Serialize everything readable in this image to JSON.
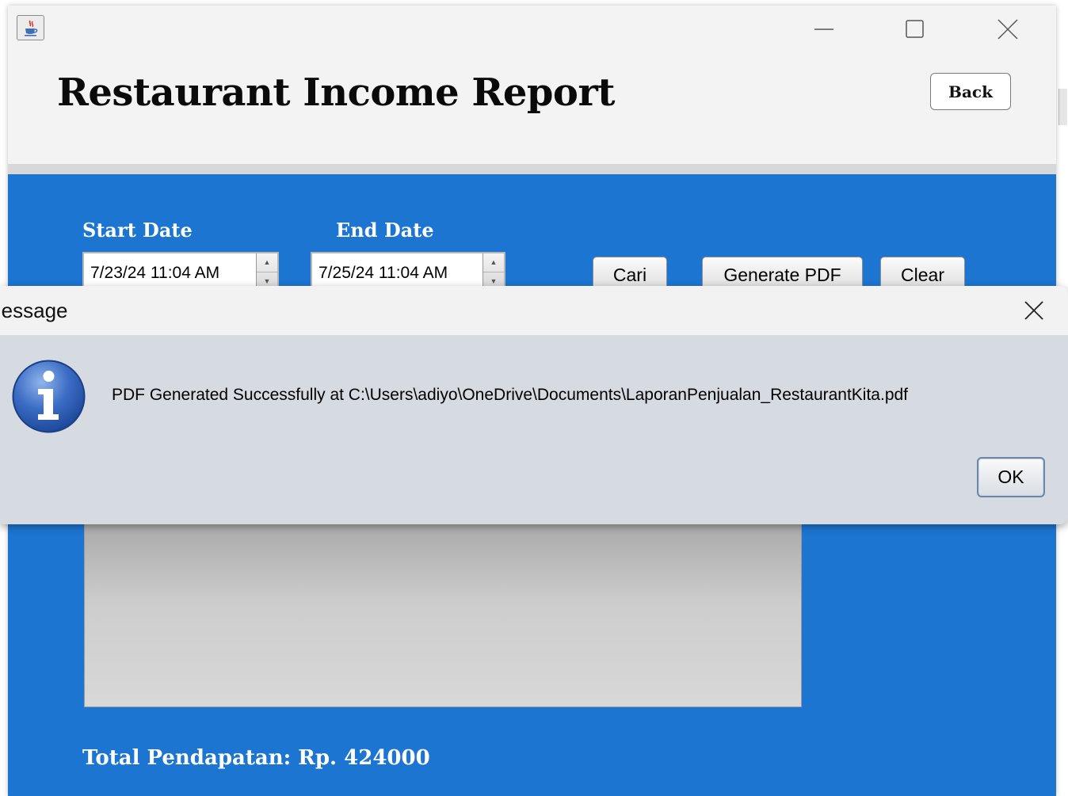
{
  "window": {
    "controls": {
      "minimize": "minimize-icon",
      "maximize": "maximize-icon",
      "close": "close-icon"
    },
    "app_icon": "java-cup-icon"
  },
  "header": {
    "title": "Restaurant Income Report",
    "back_label": "Back"
  },
  "filters": {
    "start_label": "Start Date",
    "start_value": "7/23/24 11:04 AM",
    "end_label": "End Date",
    "end_value": "7/25/24 11:04 AM"
  },
  "actions": {
    "search_label": "Cari",
    "pdf_label": "Generate PDF",
    "clear_label": "Clear"
  },
  "summary": {
    "total_text": "Total Pendapatan: Rp. 424000"
  },
  "dialog": {
    "title": "Message",
    "message": "PDF Generated Successfully at C:\\Users\\adiyo\\OneDrive\\Documents\\LaporanPenjualan_RestaurantKita.pdf",
    "ok_label": "OK",
    "icon": "info-icon"
  },
  "colors": {
    "panel_blue": "#1c75d1",
    "window_bg": "#f3f3f3",
    "dialog_bg": "#d6dae1"
  }
}
